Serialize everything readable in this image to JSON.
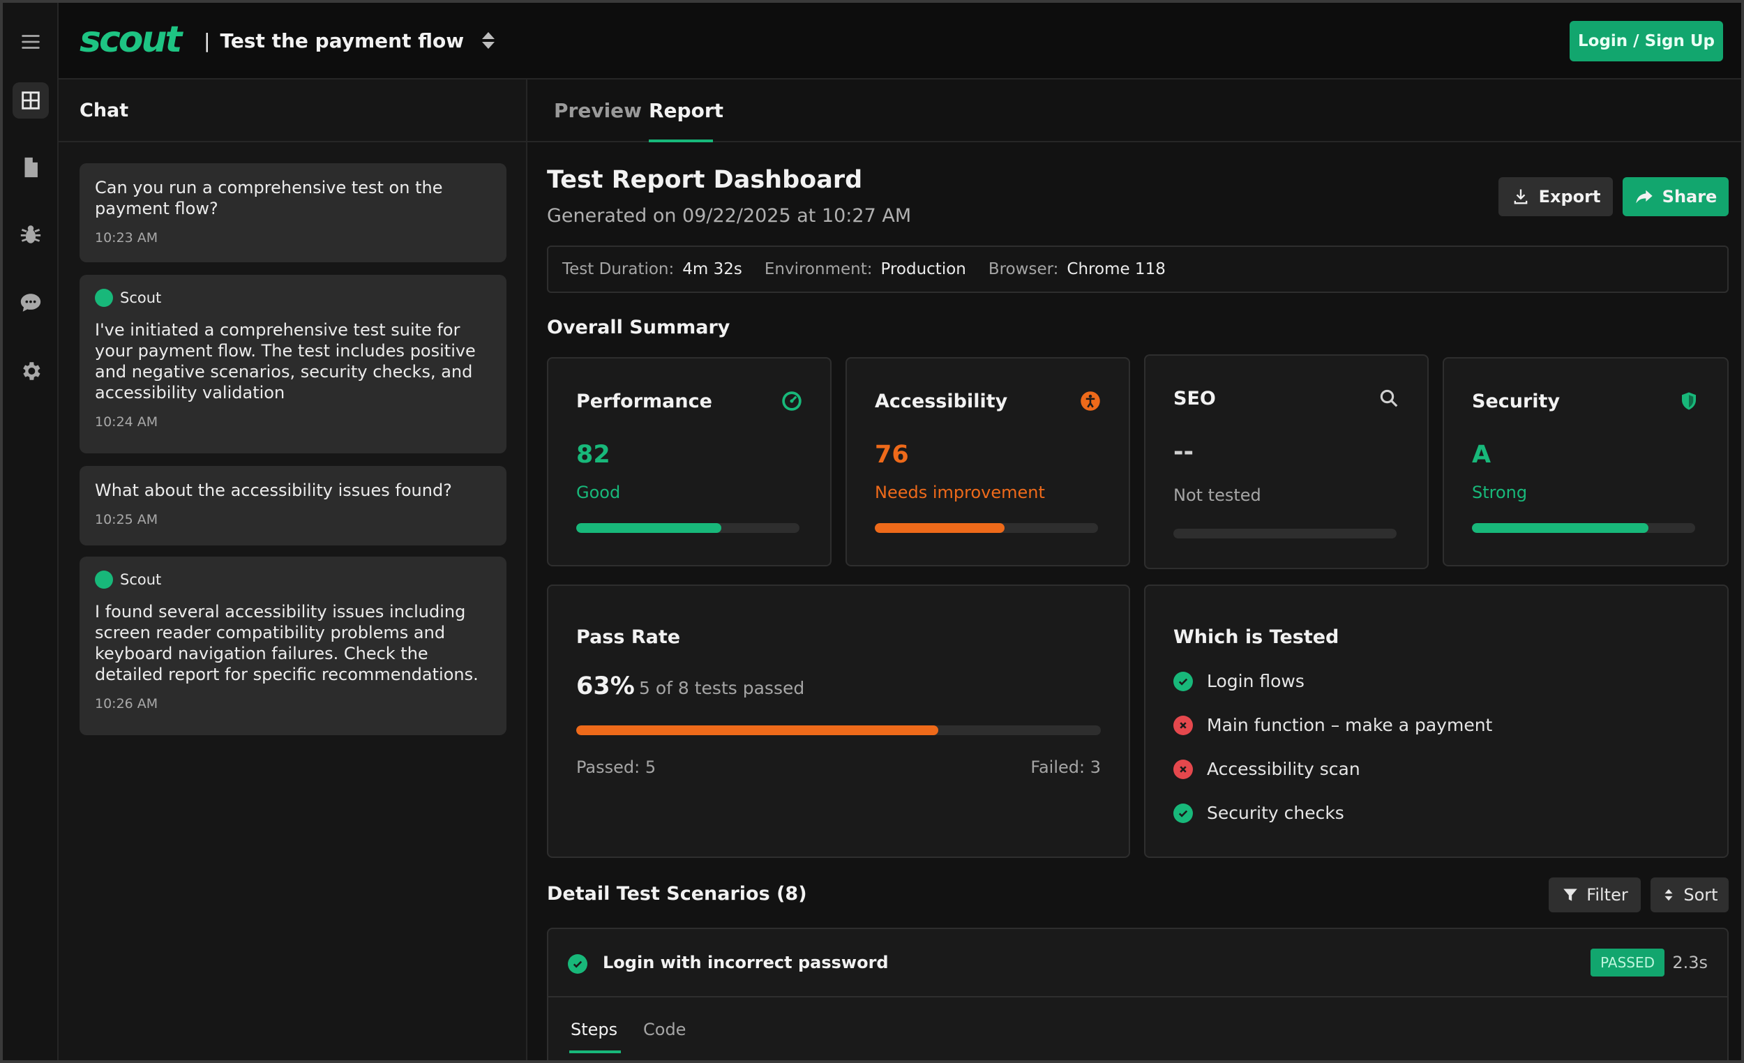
{
  "app": {
    "logo_text": "scout",
    "project_title": "Test the payment flow",
    "login_label": "Login / Sign Up"
  },
  "rail": {
    "icons": [
      "menu-icon",
      "dashboard-icon",
      "document-icon",
      "bug-icon",
      "chat-icon",
      "gear-icon"
    ]
  },
  "chat": {
    "header": "Chat",
    "messages": [
      {
        "sender": "",
        "text": "Can you run a comprehensive test on the payment flow?",
        "time": "10:23 AM"
      },
      {
        "sender": "Scout",
        "text": "I've initiated a comprehensive test suite for your payment flow. The test includes positive and negative scenarios, security checks, and accessibility validation",
        "time": "10:24 AM"
      },
      {
        "sender": "",
        "text": "What about the accessibility issues found?",
        "time": "10:25 AM"
      },
      {
        "sender": "Scout",
        "text": "I found several accessibility issues including screen reader compatibility problems and keyboard navigation failures. Check the detailed report for specific recommendations.",
        "time": "10:26 AM"
      }
    ]
  },
  "tabs": {
    "preview": "Preview",
    "report": "Report",
    "active": "report"
  },
  "report": {
    "title": "Test Report Dashboard",
    "generated": "Generated on 09/22/2025 at 10:27 AM",
    "export_label": "Export",
    "share_label": "Share",
    "meta": {
      "duration_label": "Test Duration:",
      "duration_value": "4m 32s",
      "env_label": "Environment:",
      "env_value": "Production",
      "browser_label": "Browser:",
      "browser_value": "Chrome 118"
    },
    "summary_title": "Overall Summary",
    "cards": [
      {
        "title": "Performance",
        "value": "82",
        "label": "Good",
        "progress": 0.65,
        "color": "#18b87a",
        "icon": "gauge-icon"
      },
      {
        "title": "Accessibility",
        "value": "76",
        "label": "Needs improvement",
        "progress": 0.58,
        "color": "#ee6a1a",
        "icon": "accessibility-icon"
      },
      {
        "title": "SEO",
        "value": "--",
        "label": "Not tested",
        "progress": 0,
        "color": "#a5a5a5",
        "icon": "search-icon"
      },
      {
        "title": "Security",
        "value": "A",
        "label": "Strong",
        "progress": 0.79,
        "color": "#18b87a",
        "icon": "shield-icon"
      }
    ],
    "pass_rate": {
      "title": "Pass Rate",
      "percent": "63%",
      "subtitle": "5 of 8 tests passed",
      "progress": 0.69,
      "passed": "Passed: 5",
      "failed": "Failed: 3"
    },
    "tested": {
      "title": "Which is Tested",
      "items": [
        {
          "label": "Login flows",
          "status": "pass"
        },
        {
          "label": "Main function – make a payment",
          "status": "fail"
        },
        {
          "label": "Accessibility scan",
          "status": "fail"
        },
        {
          "label": "Security checks",
          "status": "pass"
        }
      ]
    },
    "scenarios_title": "Detail Test Scenarios (8)",
    "filter_label": "Filter",
    "sort_label": "Sort",
    "scenario": {
      "name": "Login with incorrect password",
      "status": "PASSED",
      "time": "2.3s",
      "tab_steps": "Steps",
      "tab_code": "Code"
    }
  },
  "colors": {
    "accent": "#18b87a",
    "warning": "#ee6a1a",
    "danger": "#e5484d"
  }
}
